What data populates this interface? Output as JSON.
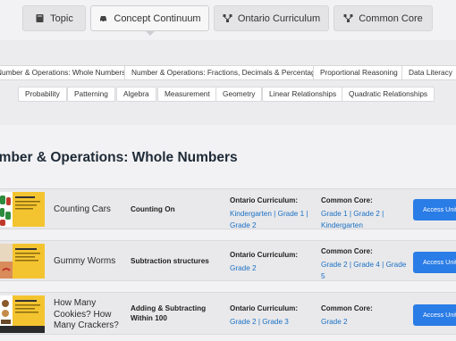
{
  "tabs": [
    {
      "label": "Topic",
      "icon": "book-icon",
      "active": false
    },
    {
      "label": "Concept Continuum",
      "icon": "car-icon",
      "active": true
    },
    {
      "label": "Ontario Curriculum",
      "icon": "sitemap-icon",
      "active": false
    },
    {
      "label": "Common Core",
      "icon": "sitemap-icon",
      "active": false
    }
  ],
  "topics": {
    "row1": [
      "Number & Operations: Whole Numbers",
      "Number & Operations: Fractions, Decimals & Percentages",
      "Proportional Reasoning",
      "Data Literacy"
    ],
    "row2": [
      "Probability",
      "Patterning",
      "Algebra",
      "Measurement",
      "Geometry",
      "Linear Relationships",
      "Quadratic Relationships"
    ]
  },
  "section": {
    "title": "Number & Operations: Whole Numbers"
  },
  "labels": {
    "ontario": "Ontario Curriculum:",
    "common_core": "Common Core:",
    "access": "Access Unit"
  },
  "units": [
    {
      "title": "Counting Cars",
      "concept": "Counting On",
      "ontario": [
        "Kindergarten",
        "Grade 1",
        "Grade 2"
      ],
      "common_core": [
        "Grade 1",
        "Grade 2",
        "Kindergarten"
      ],
      "thumb_text": "Counting Cars"
    },
    {
      "title": "Gummy Worms",
      "concept": "Subtraction structures",
      "ontario": [
        "Grade 2"
      ],
      "common_core": [
        "Grade 2",
        "Grade 4",
        "Grade 5"
      ],
      "thumb_text": "Gummy Worms"
    },
    {
      "title": "How Many Cookies? How Many Crackers?",
      "concept": "Adding & Subtracting Within 100",
      "ontario": [
        "Grade 2",
        "Grade 3"
      ],
      "common_core": [
        "Grade 2"
      ],
      "thumb_text": "How Many Cookies?"
    }
  ],
  "colors": {
    "accent": "#2a7ce6",
    "link": "#1a6fc4",
    "title": "#1e2a36",
    "thumb_yellow": "#f4c430"
  }
}
